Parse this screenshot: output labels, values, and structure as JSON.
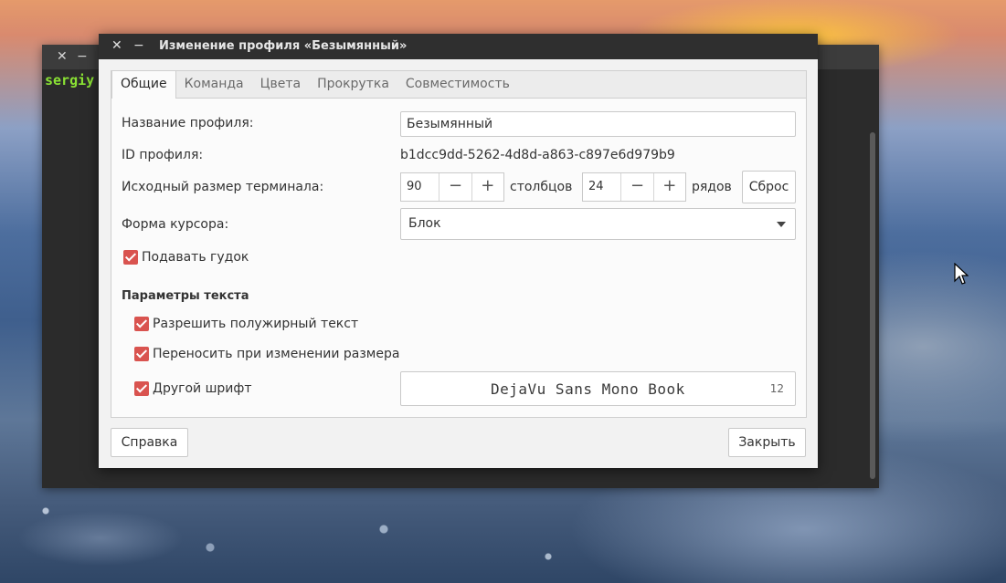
{
  "terminal": {
    "prompt": "sergiy",
    "close": "✕",
    "minimize": "−"
  },
  "dialog": {
    "title": "Изменение профиля «Безымянный»",
    "close": "✕",
    "minimize": "−",
    "tabs": [
      "Общие",
      "Команда",
      "Цвета",
      "Прокрутка",
      "Совместимость"
    ],
    "active_tab": "Общие",
    "profile_name_label": "Название профиля:",
    "profile_name_value": "Безымянный",
    "profile_id_label": "ID профиля:",
    "profile_id_value": "b1dcc9dd-5262-4d8d-a863-c897e6d979b9",
    "size_label": "Исходный размер терминала:",
    "columns_value": "90",
    "columns_unit": "столбцов",
    "rows_value": "24",
    "rows_unit": "рядов",
    "minus": "−",
    "plus": "+",
    "reset_button": "Сброс",
    "cursor_label": "Форма курсора:",
    "cursor_value": "Блок",
    "beep_label": "Подавать гудок",
    "text_section": "Параметры текста",
    "bold_label": "Разрешить полужирный текст",
    "rewrap_label": "Переносить при изменении размера",
    "custom_font_label": "Другой шрифт",
    "font_name": "DejaVu Sans Mono Book",
    "font_size": "12",
    "help_button": "Справка",
    "close_button": "Закрыть"
  }
}
